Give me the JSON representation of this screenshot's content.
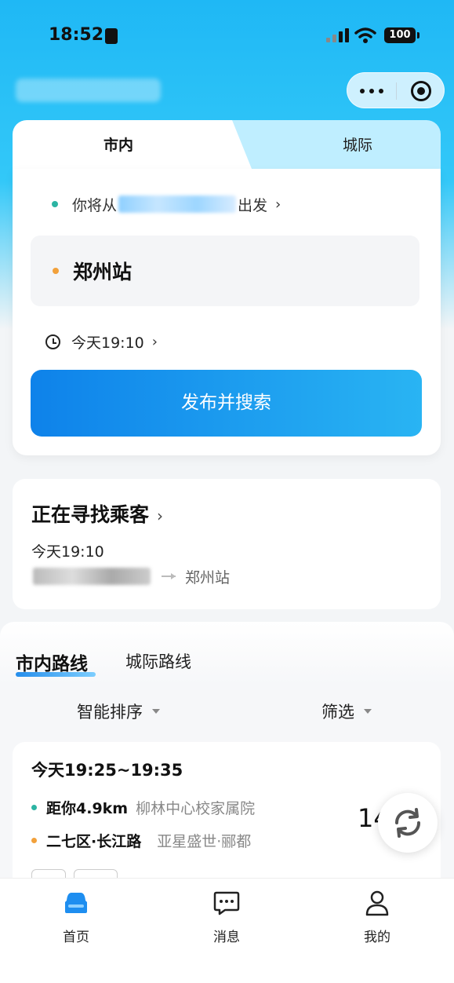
{
  "status_bar": {
    "time": "18:52",
    "battery": "100"
  },
  "booking": {
    "tabs": [
      "市内",
      "城际"
    ],
    "from_prefix": "你将从",
    "from_suffix": "出发",
    "destination": "郑州站",
    "depart_time": "今天19:10",
    "search_button": "发布并搜索"
  },
  "seeking": {
    "title": "正在寻找乘客",
    "time": "今天19:10",
    "route_to": "郑州站"
  },
  "routes": {
    "tabs": [
      "市内路线",
      "城际路线"
    ],
    "sort_label": "智能排序",
    "filter_label": "筛选",
    "card": {
      "time_range": "今天19:25~19:35",
      "from_distance": "距你4.9km",
      "from_place": "柳林中心校家属院",
      "to_area": "二七区·长江路",
      "to_place": "亚星盛世·郦都",
      "price": "14"
    }
  },
  "bottom_nav": {
    "home": "首页",
    "messages": "消息",
    "mine": "我的"
  },
  "colors": {
    "primary": "#0e82ea",
    "start_dot": "#2cb4a3",
    "end_dot": "#f2a13b"
  }
}
